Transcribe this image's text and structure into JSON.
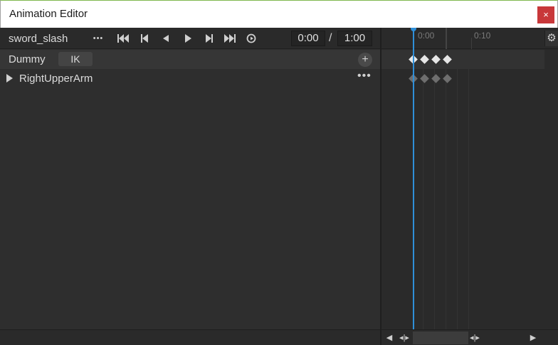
{
  "window": {
    "title": "Animation Editor",
    "close_glyph": "×"
  },
  "toolbar": {
    "animation_name": "sword_slash",
    "more_glyph": "•••",
    "current_time": "0:00",
    "separator": "/",
    "end_time": "1:00"
  },
  "tracks": [
    {
      "label": "Dummy",
      "ik_label": "IK",
      "add_glyph": "+"
    },
    {
      "label": "RightUpperArm",
      "more_glyph": "•••"
    }
  ],
  "timeline": {
    "ruler_labels": [
      "0:00",
      "0:10"
    ],
    "settings_glyph": "⚙",
    "playhead_color": "#2f8fd8",
    "keyframe_colors": {
      "selected": "#e6e6e6",
      "child": "#6e6e6e"
    },
    "keyframes_per_row": 4
  },
  "scrollbar": {
    "left_arrow": "◀",
    "right_arrow": "▶",
    "handle_glyph": "◂|▸"
  },
  "colors": {
    "close_button": "#c8383a",
    "titlebar_accent": "#7fb84e"
  },
  "icons": [
    "first-frame-icon",
    "prev-keyframe-icon",
    "prev-frame-icon",
    "play-icon",
    "next-keyframe-icon",
    "last-frame-icon",
    "loop-icon",
    "add-icon",
    "gear-icon"
  ]
}
